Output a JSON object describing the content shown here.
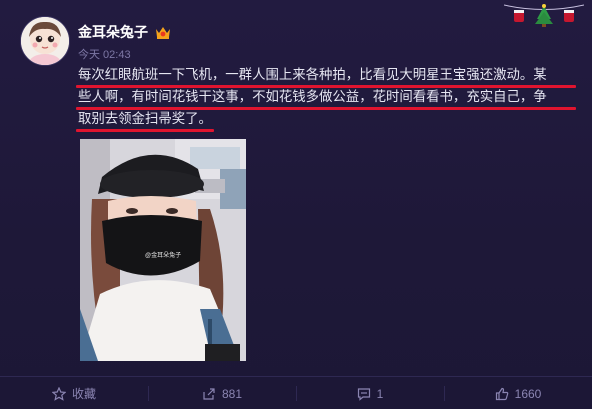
{
  "user": {
    "name": "金耳朵兔子",
    "badge_icon": "vip-badge-icon",
    "timestamp": "今天 02:43"
  },
  "post": {
    "lines": [
      "每次红眼航班一下飞机，一群人围上来各种拍，比看见大明星王宝强还激动。某",
      "些人啊，有时间花钱干这事，不如花钱多做公益，花时间看看书，充实自己，争",
      "取别去领金扫帚奖了。"
    ],
    "photo_watermark": "@金耳朵兔子"
  },
  "actions": {
    "favorite": {
      "label": "收藏",
      "icon": "star-icon"
    },
    "repost": {
      "count": "881",
      "icon": "repost-icon"
    },
    "comment": {
      "count": "1",
      "icon": "comment-icon"
    },
    "like": {
      "count": "1660",
      "icon": "thumbs-up-icon"
    }
  },
  "colors": {
    "background": "#1f1a3a",
    "highlight_underline": "#e0142f",
    "muted_text": "#8b85b2"
  }
}
